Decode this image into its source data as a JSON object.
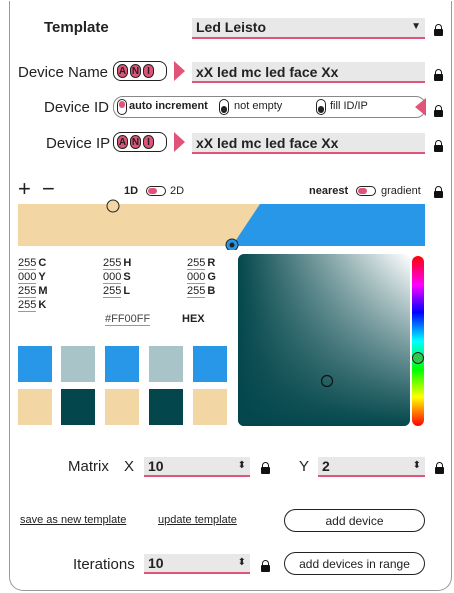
{
  "template": {
    "label": "Template",
    "value": "Led Leisto"
  },
  "device_name": {
    "label": "Device Name",
    "value": "xX led mc led face Xx",
    "ani": [
      "A",
      "N",
      "I"
    ]
  },
  "device_id": {
    "label": "Device ID",
    "options": [
      "auto increment",
      "not empty",
      "fill ID/IP"
    ]
  },
  "device_ip": {
    "label": "Device IP",
    "value": "xX led mc led face Xx",
    "ani": [
      "A",
      "N",
      "I"
    ]
  },
  "gradient_bar": {
    "plus": "+",
    "minus": "−",
    "mode_1d": "1D",
    "mode_2d": "2D",
    "interp_nearest": "nearest",
    "interp_gradient": "gradient",
    "left_color": "#f2d6a4",
    "right_color": "#2897e8"
  },
  "color_values": {
    "cmyk": [
      {
        "v": "255",
        "l": "C"
      },
      {
        "v": "000",
        "l": "Y"
      },
      {
        "v": "255",
        "l": "M"
      },
      {
        "v": "255",
        "l": "K"
      }
    ],
    "hsl": [
      {
        "v": "255",
        "l": "H"
      },
      {
        "v": "000",
        "l": "S"
      },
      {
        "v": "255",
        "l": "L"
      }
    ],
    "rgb": [
      {
        "v": "255",
        "l": "R"
      },
      {
        "v": "000",
        "l": "G"
      },
      {
        "v": "255",
        "l": "B"
      }
    ],
    "hex_value": "#FF00FF",
    "hex_label": "HEX"
  },
  "swatches": {
    "row1": [
      "#2897e8",
      "#a9c4c8",
      "#2897e8",
      "#a9c4c8",
      "#2897e8"
    ],
    "row2": [
      "#f2d6a4",
      "#03474c",
      "#f2d6a4",
      "#03474c",
      "#f2d6a4"
    ]
  },
  "picker": {
    "base_color": "#03474c"
  },
  "matrix": {
    "label": "Matrix",
    "x_label": "X",
    "x_value": "10",
    "y_label": "Y",
    "y_value": "2"
  },
  "actions": {
    "save_template": "save as new template",
    "update_template": "update template",
    "add_device": "add device",
    "iterations_label": "Iterations",
    "iterations_value": "10",
    "add_range": "add devices in range"
  }
}
